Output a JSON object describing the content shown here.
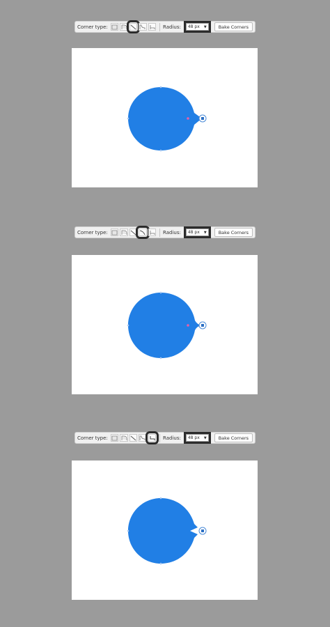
{
  "colors": {
    "background": "#9b9b9b",
    "shape_fill": "#217fe5",
    "canvas": "#ffffff",
    "selection_outline": "#2b2b2b"
  },
  "panels": [
    {
      "corner_type_label": "Corner type:",
      "radius_label": "Radius:",
      "radius_value": "48 px",
      "bake_label": "Bake Corners",
      "selected_corner_type": 2
    },
    {
      "corner_type_label": "Corner type:",
      "radius_label": "Radius:",
      "radius_value": "48 px",
      "bake_label": "Bake Corners",
      "selected_corner_type": 3
    },
    {
      "corner_type_label": "Corner type:",
      "radius_label": "Radius:",
      "radius_value": "48 px",
      "bake_label": "Bake Corners",
      "selected_corner_type": 4
    }
  ],
  "corner_types": [
    "none-icon",
    "rounded-icon",
    "straight-icon",
    "concave-icon",
    "inverted-icon"
  ]
}
